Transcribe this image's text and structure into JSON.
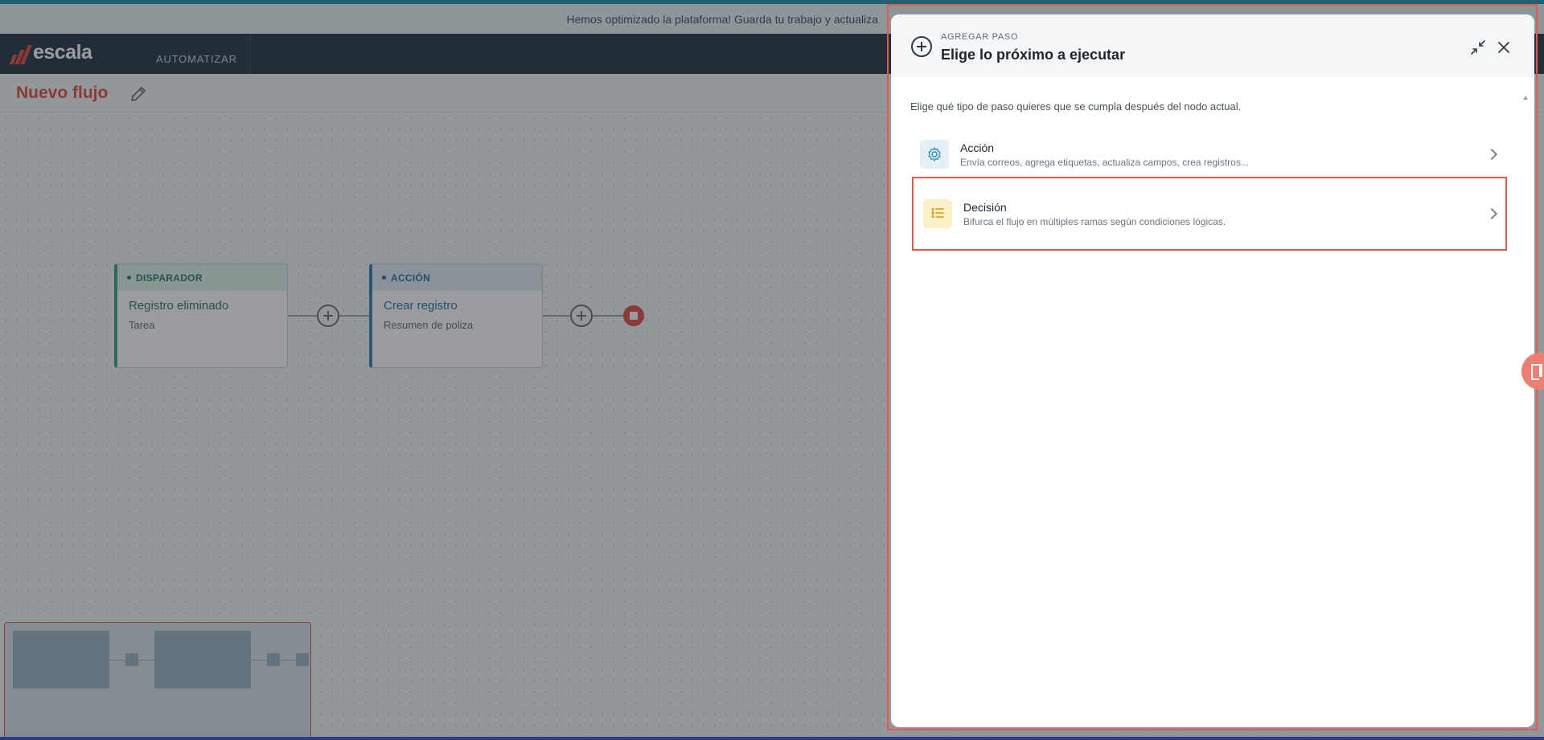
{
  "banner": {
    "text": "Hemos optimizado la plataforma! Guarda tu trabajo y actualiza"
  },
  "header": {
    "logo_text": "escala",
    "nav_automatizar": "AUTOMATIZAR"
  },
  "flow": {
    "title": "Nuevo flujo"
  },
  "nodes": {
    "trigger": {
      "tag": "DISPARADOR",
      "title": "Registro eliminado",
      "subtitle": "Tarea"
    },
    "action": {
      "tag": "ACCIÓN",
      "title": "Crear registro",
      "subtitle": "Resumen de poliza"
    }
  },
  "panel": {
    "eyebrow": "AGREGAR PASO",
    "title": "Elige lo próximo a ejecutar",
    "intro": "Elige qué tipo de paso quieres que se cumpla después del nodo actual.",
    "options": [
      {
        "title": "Acción",
        "description": "Envía correos, agrega etiquetas, actualiza campos, crea registros..."
      },
      {
        "title": "Decisión",
        "description": "Bifurca el flujo en múltiples ramas según condiciones lógicas."
      }
    ]
  },
  "icons": {
    "panel_header": "plus-circle-icon",
    "minimize": "minimize-icon",
    "close": "close-icon",
    "action_option": "gear-icon",
    "decision_option": "list-icon",
    "edit_title": "pencil-icon"
  },
  "colors": {
    "brand_red": "#e2483b",
    "header_bg": "#1f2f3b",
    "trigger_green": "#2aa079",
    "action_blue": "#2a7fb0",
    "decision_yellow": "#fdf0c7",
    "highlight_border": "#e05a4e"
  }
}
